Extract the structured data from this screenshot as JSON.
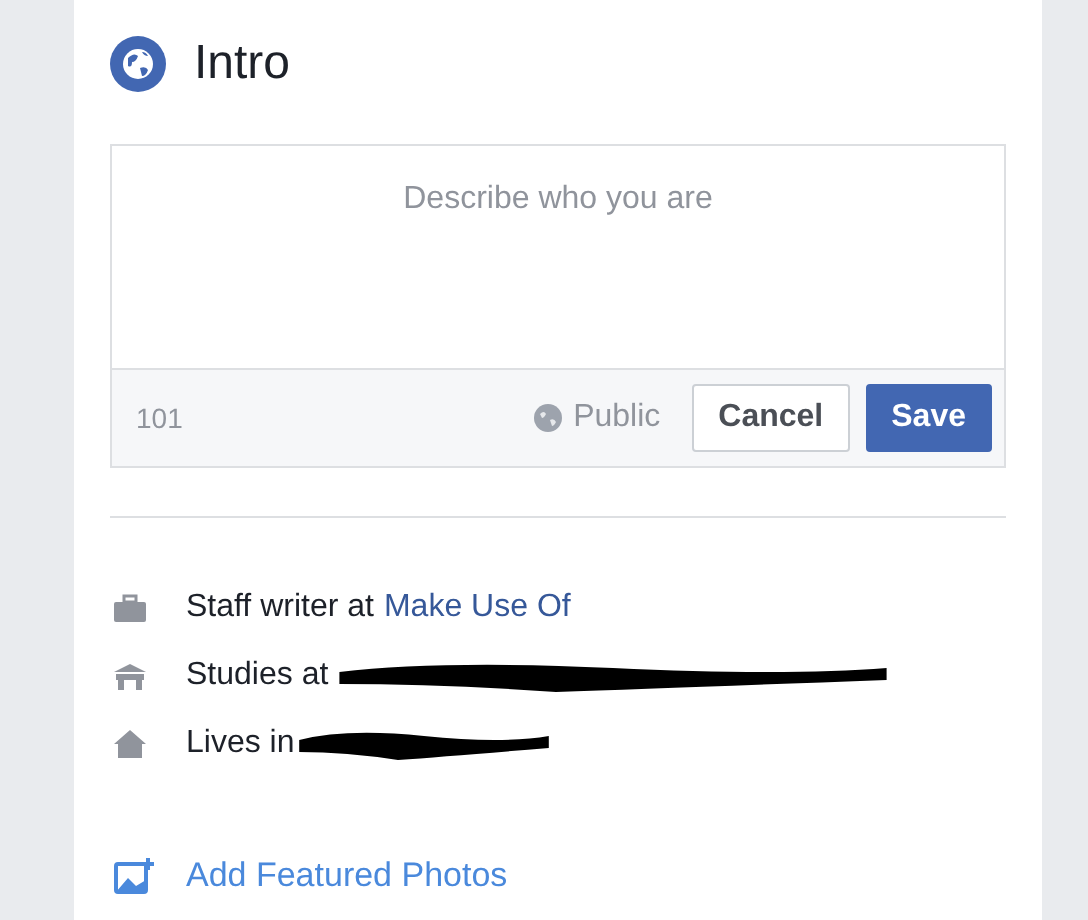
{
  "card": {
    "title": "Intro"
  },
  "bio": {
    "placeholder": "Describe who you are",
    "counter": "101",
    "audience": "Public",
    "buttons": [
      "Cancel",
      "Save"
    ]
  },
  "details": [
    {
      "kind": "work",
      "text": "Staff writer at",
      "link": "Make Use Of",
      "redacted": false
    },
    {
      "kind": "education",
      "text": "Studies at",
      "redacted": true
    },
    {
      "kind": "home",
      "text": "Lives in",
      "redacted": true
    }
  ],
  "add_photos": "Add Featured Photos"
}
